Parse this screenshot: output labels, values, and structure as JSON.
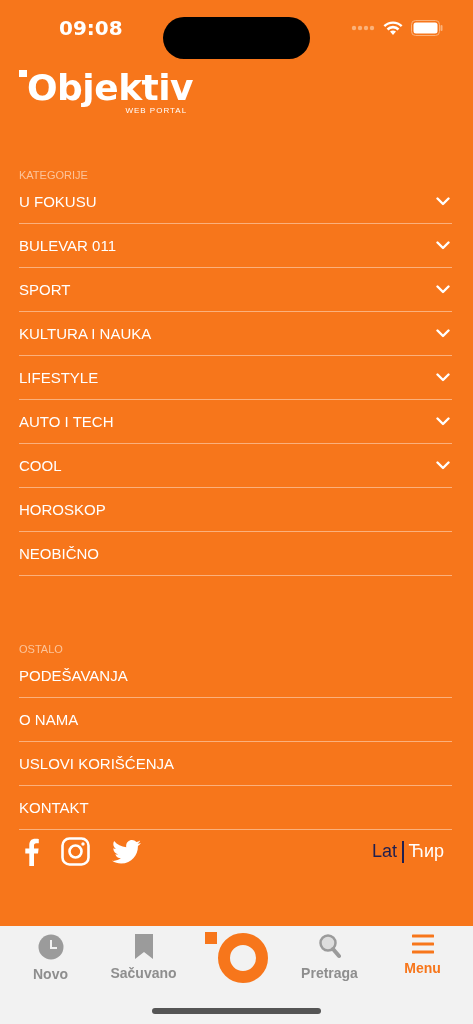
{
  "status_bar": {
    "time": "09:08"
  },
  "logo": {
    "name": "Objektiv",
    "tagline": "WEB PORTAL"
  },
  "sections": [
    {
      "title": "KATEGORIJE",
      "items": [
        {
          "label": "U FOKUSU",
          "expandable": true
        },
        {
          "label": "BULEVAR 011",
          "expandable": true
        },
        {
          "label": "SPORT",
          "expandable": true
        },
        {
          "label": "KULTURA I NAUKA",
          "expandable": true
        },
        {
          "label": "LIFESTYLE",
          "expandable": true
        },
        {
          "label": "AUTO I TECH",
          "expandable": true
        },
        {
          "label": "COOL",
          "expandable": true
        },
        {
          "label": "HOROSKOP",
          "expandable": false
        },
        {
          "label": "NEOBIČNO",
          "expandable": false
        }
      ]
    },
    {
      "title": "OSTALO",
      "items": [
        {
          "label": "PODEŠAVANJA",
          "expandable": false
        },
        {
          "label": "O NAMA",
          "expandable": false
        },
        {
          "label": "USLOVI KORIŠĆENJA",
          "expandable": false
        },
        {
          "label": "KONTAKT",
          "expandable": false
        }
      ]
    }
  ],
  "social": [
    {
      "kind": "facebook"
    },
    {
      "kind": "instagram"
    },
    {
      "kind": "twitter"
    }
  ],
  "script_toggle": [
    {
      "label": "Lat",
      "selected": true
    },
    {
      "label": "Ћир",
      "selected": false
    }
  ],
  "tab_bar": [
    {
      "kind": "clock",
      "label": "Novo",
      "selected": false
    },
    {
      "kind": "bookmark",
      "label": "Sačuvano",
      "selected": false
    },
    {
      "kind": "logo"
    },
    {
      "kind": "search",
      "label": "Pretraga",
      "selected": false
    },
    {
      "kind": "menu",
      "label": "Menu",
      "selected": true
    }
  ]
}
